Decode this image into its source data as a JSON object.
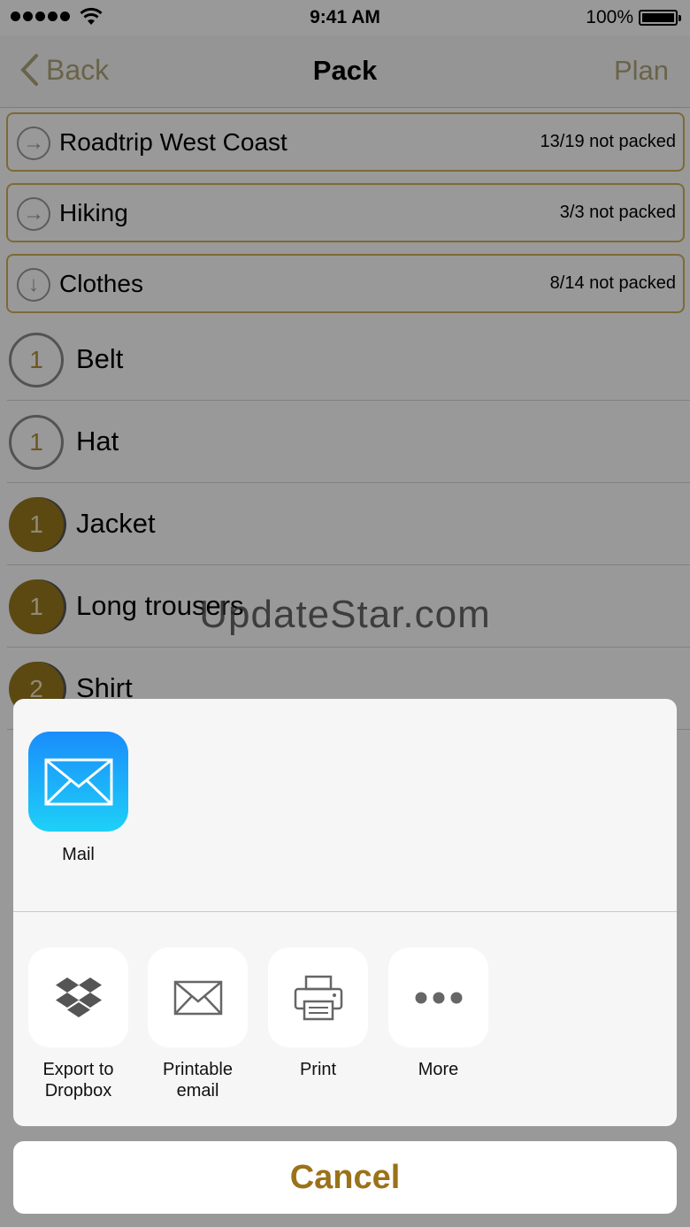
{
  "status": {
    "time": "9:41 AM",
    "battery": "100%"
  },
  "nav": {
    "back_label": "Back",
    "title": "Pack",
    "right_label": "Plan"
  },
  "groups": [
    {
      "name": "Roadtrip West Coast",
      "count": "13/19 not packed",
      "icon": "arrow-right-icon"
    },
    {
      "name": "Hiking",
      "count": "3/3 not packed",
      "icon": "arrow-right-icon"
    },
    {
      "name": "Clothes",
      "count": "8/14 not packed",
      "icon": "arrow-down-icon"
    }
  ],
  "items": [
    {
      "qty": "1",
      "name": "Belt",
      "packed": false
    },
    {
      "qty": "1",
      "name": "Hat",
      "packed": false
    },
    {
      "qty": "1",
      "name": "Jacket",
      "packed": true
    },
    {
      "qty": "1",
      "name": "Long trousers",
      "packed": true
    },
    {
      "qty": "2",
      "name": "Shirt",
      "packed": true
    }
  ],
  "watermark": "UpdateStar.com",
  "share_sheet": {
    "apps": [
      {
        "label": "Mail",
        "icon": "mail-icon"
      }
    ],
    "actions": [
      {
        "label_line1": "Export to",
        "label_line2": "Dropbox",
        "icon": "dropbox-icon"
      },
      {
        "label_line1": "Printable",
        "label_line2": "email",
        "icon": "envelope-icon"
      },
      {
        "label_line1": "Print",
        "label_line2": "",
        "icon": "printer-icon"
      },
      {
        "label_line1": "More",
        "label_line2": "",
        "icon": "more-icon"
      }
    ],
    "cancel_label": "Cancel"
  },
  "colors": {
    "accent": "#9a7219",
    "group_border": "#d0b158",
    "mail_gradient_top": "#1a8dfb",
    "mail_gradient_bottom": "#1ed0f8"
  }
}
